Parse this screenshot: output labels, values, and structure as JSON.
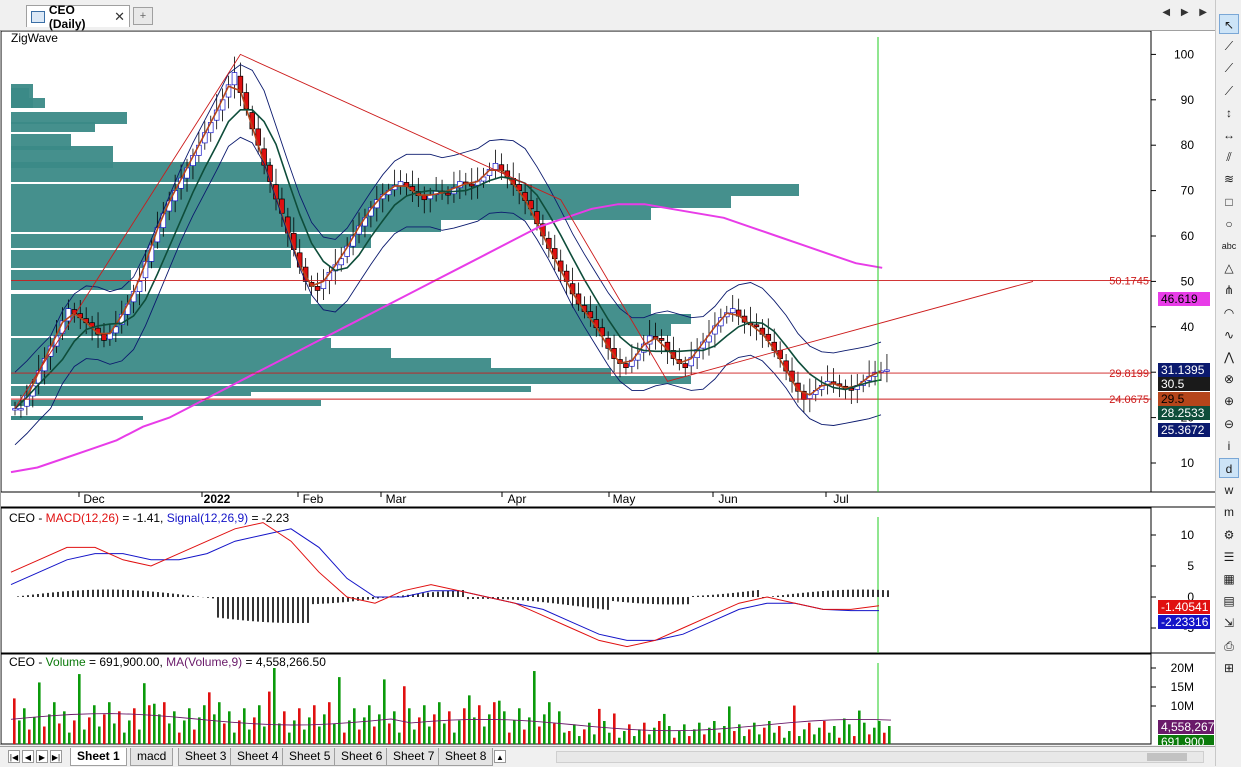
{
  "window": {
    "tab_title": "CEO (Daily)",
    "close_glyph": "✕",
    "add_glyph": "+",
    "nav_glyphs": "◀ ▶ ▶"
  },
  "price_panel": {
    "indicator_label": "ZigWave",
    "y_ticks": [
      "100",
      "90",
      "80",
      "70",
      "60",
      "50",
      "40",
      "30",
      "20",
      "10"
    ],
    "x_labels": [
      "Dec",
      "2022",
      "Feb",
      "Mar",
      "Apr",
      "May",
      "Jun",
      "Jul"
    ],
    "level_labels": [
      "50.1745",
      "29.8199",
      "24.0675"
    ],
    "badges": [
      {
        "text": "46.619",
        "bg": "#e83ce8",
        "fg": "#000000"
      },
      {
        "text": "31.1395",
        "bg": "#0b1a6e",
        "fg": "#ffffff"
      },
      {
        "text": "30.5",
        "bg": "#1a1a1a",
        "fg": "#ffffff"
      },
      {
        "text": "29.5",
        "bg": "#b5451b",
        "fg": "#000000"
      },
      {
        "text": "28.2533",
        "bg": "#0e4d3a",
        "fg": "#ffffff"
      },
      {
        "text": "25.3672",
        "bg": "#0b1a6e",
        "fg": "#ffffff"
      }
    ]
  },
  "macd_panel": {
    "legend": {
      "sym": "CEO - ",
      "macd_name": "MACD(12,26)",
      "macd_value": " = -1.41, ",
      "signal_name": "Signal(12,26,9)",
      "signal_value": " = -2.23"
    },
    "y_ticks": [
      "10",
      "5",
      "0",
      "-5"
    ],
    "badges": [
      {
        "text": "-1.40541",
        "bg": "#e01010",
        "fg": "#ffffff"
      },
      {
        "text": "-2.23316",
        "bg": "#1414c8",
        "fg": "#ffffff"
      }
    ]
  },
  "volume_panel": {
    "legend": {
      "sym": "CEO - ",
      "vol_name": "Volume",
      "vol_value": " = 691,900.00, ",
      "ma_name": "MA(Volume,9)",
      "ma_value": " = 4,558,266.50"
    },
    "y_ticks": [
      "20M",
      "15M",
      "10M"
    ],
    "badges": [
      {
        "text": "4,558,267",
        "bg": "#6a1a6a",
        "fg": "#ffffff"
      },
      {
        "text": "691,900",
        "bg": "#0b7a0b",
        "fg": "#ffffff"
      }
    ]
  },
  "sheets": {
    "tabs": [
      "Sheet 1",
      "macd",
      "Sheet 3",
      "Sheet 4",
      "Sheet 5",
      "Sheet 6",
      "Sheet 7",
      "Sheet 8"
    ],
    "active": "Sheet 1",
    "extra": "▲"
  },
  "toolbar": {
    "tools": [
      {
        "name": "pointer-tool-icon",
        "glyph": "↖",
        "selected": true
      },
      {
        "name": "line-tool-icon",
        "glyph": "⟋"
      },
      {
        "name": "ray-tool-icon",
        "glyph": "⟋"
      },
      {
        "name": "extended-line-tool-icon",
        "glyph": "⟋"
      },
      {
        "name": "vertical-line-tool-icon",
        "glyph": "↕"
      },
      {
        "name": "horizontal-line-tool-icon",
        "glyph": "↔"
      },
      {
        "name": "parallel-lines-tool-icon",
        "glyph": "⫽"
      },
      {
        "name": "fibonacci-tool-icon",
        "glyph": "≋"
      },
      {
        "name": "rectangle-tool-icon",
        "glyph": "□"
      },
      {
        "name": "ellipse-tool-icon",
        "glyph": "○"
      },
      {
        "name": "text-tool-icon",
        "glyph": "abc"
      },
      {
        "name": "triangle-tool-icon",
        "glyph": "△"
      },
      {
        "name": "pitchfork-tool-icon",
        "glyph": "⋔"
      },
      {
        "name": "arc-tool-icon",
        "glyph": "◠"
      },
      {
        "name": "cycle-tool-icon",
        "glyph": "∿"
      },
      {
        "name": "zigzag-tool-icon",
        "glyph": "⋀"
      },
      {
        "name": "delete-tool-icon",
        "glyph": "⊗"
      },
      {
        "name": "zoom-tool-icon",
        "glyph": "⊕"
      },
      {
        "name": "zoom-out-tool-icon",
        "glyph": "⊖"
      },
      {
        "name": "info-tool-icon",
        "glyph": "i"
      },
      {
        "name": "daily-period-icon",
        "glyph": "d",
        "selected": true
      },
      {
        "name": "weekly-period-icon",
        "glyph": "w"
      },
      {
        "name": "monthly-period-icon",
        "glyph": "m"
      },
      {
        "name": "properties-icon",
        "glyph": "⚙"
      },
      {
        "name": "list-icon",
        "glyph": "☰"
      },
      {
        "name": "table-icon",
        "glyph": "▦"
      },
      {
        "name": "chart-icon",
        "glyph": "▤"
      },
      {
        "name": "export-icon",
        "glyph": "⇲"
      },
      {
        "name": "print-icon",
        "glyph": "⎙"
      },
      {
        "name": "grid-icon",
        "glyph": "⊞"
      }
    ]
  },
  "chart_data": [
    {
      "type": "candlestick",
      "title": "CEO (Daily)",
      "x_labels": [
        "Dec",
        "2022",
        "Feb",
        "Mar",
        "Apr",
        "May",
        "Jun",
        "Jul"
      ],
      "ylim": [
        0,
        105
      ],
      "close_series_approx": [
        22,
        27,
        33,
        38,
        44,
        42,
        40,
        37,
        40,
        45,
        50,
        58,
        65,
        70,
        75,
        80,
        85,
        90,
        96,
        88,
        80,
        72,
        65,
        57,
        50,
        48,
        52,
        55,
        60,
        64,
        68,
        70,
        72,
        70,
        68,
        70,
        69,
        72,
        71,
        73,
        76,
        73,
        70,
        66,
        60,
        55,
        50,
        45,
        42,
        38,
        33,
        31,
        34,
        38,
        37,
        33,
        31,
        35,
        38,
        42,
        44,
        41,
        40,
        37,
        33,
        28,
        24,
        26,
        28,
        27,
        26,
        28,
        30,
        30.5
      ],
      "last": {
        "open": 29.5,
        "close": 30.5
      },
      "overlays": [
        {
          "name": "ZigWave",
          "color": "#cc1a1a",
          "points_x_index": [
            0,
            19,
            46,
            55,
            74
          ],
          "points_y": [
            22,
            100,
            68,
            28,
            50
          ]
        },
        {
          "name": "MA long",
          "color": "#e83ce8",
          "last": 46.619
        },
        {
          "name": "Bollinger upper",
          "color": "#0b1a6e",
          "last": 31.1395
        },
        {
          "name": "Bollinger lower",
          "color": "#0b1a6e",
          "last": 25.3672
        },
        {
          "name": "MA fast",
          "color": "#b5451b",
          "last": 29.5
        },
        {
          "name": "MA slow",
          "color": "#0e4d3a",
          "last": 28.2533
        }
      ],
      "horizontal_levels": [
        50.1745,
        29.8199,
        24.0675
      ],
      "volume_profile": true
    },
    {
      "type": "line",
      "title": "MACD(12,26)",
      "series": [
        {
          "name": "MACD(12,26)",
          "color": "#e01010",
          "last": -1.41
        },
        {
          "name": "Signal(12,26,9)",
          "color": "#1414c8",
          "last": -2.23
        }
      ],
      "histogram": true,
      "ylim": [
        -8,
        14
      ]
    },
    {
      "type": "bar",
      "title": "Volume",
      "series": [
        {
          "name": "Volume",
          "last": 691900
        },
        {
          "name": "MA(Volume,9)",
          "color": "#6a1a6a",
          "last": 4558266.5
        }
      ],
      "ylim": [
        0,
        22000000
      ]
    }
  ]
}
